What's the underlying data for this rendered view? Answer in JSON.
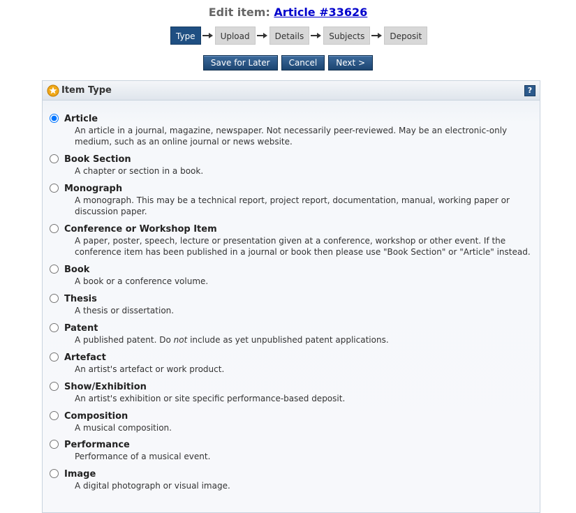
{
  "header": {
    "prefix": "Edit item:",
    "link": "Article #33626"
  },
  "steps": [
    "Type",
    "Upload",
    "Details",
    "Subjects",
    "Deposit"
  ],
  "buttons": {
    "save_later": "Save for Later",
    "cancel": "Cancel",
    "next": "Next >"
  },
  "panel": {
    "title": "Item Type",
    "help": "?",
    "icon": "star-icon",
    "help_icon": "help-icon"
  },
  "options": [
    {
      "title": "Article",
      "checked": true,
      "desc": "An article in a journal, magazine, newspaper. Not necessarily peer-reviewed. May be an electronic-only medium, such as an online journal or news website."
    },
    {
      "title": "Book Section",
      "checked": false,
      "desc": "A chapter or section in a book."
    },
    {
      "title": "Monograph",
      "checked": false,
      "desc": "A monograph. This may be a technical report, project report, documentation, manual, working paper or discussion paper."
    },
    {
      "title": "Conference or Workshop Item",
      "checked": false,
      "desc": "A paper, poster, speech, lecture or presentation given at a conference, workshop or other event. If the conference item has been published in a journal or book then please use \"Book Section\" or \"Article\" instead."
    },
    {
      "title": "Book",
      "checked": false,
      "desc": "A book or a conference volume."
    },
    {
      "title": "Thesis",
      "checked": false,
      "desc": "A thesis or dissertation."
    },
    {
      "title": "Patent",
      "checked": false,
      "desc_pre": "A published patent. Do ",
      "desc_em": "not",
      "desc_post": " include as yet unpublished patent applications."
    },
    {
      "title": "Artefact",
      "checked": false,
      "desc": "An artist's artefact or work product."
    },
    {
      "title": "Show/Exhibition",
      "checked": false,
      "desc": "An artist's exhibition or site specific performance-based deposit."
    },
    {
      "title": "Composition",
      "checked": false,
      "desc": "A musical composition."
    },
    {
      "title": "Performance",
      "checked": false,
      "desc": "Performance of a musical event."
    },
    {
      "title": "Image",
      "checked": false,
      "desc": "A digital photograph or visual image."
    }
  ],
  "colors": {
    "active_step": "#1f4f82",
    "step": "#d8d8d8",
    "button": "#1c4571",
    "link": "#0000cc"
  }
}
